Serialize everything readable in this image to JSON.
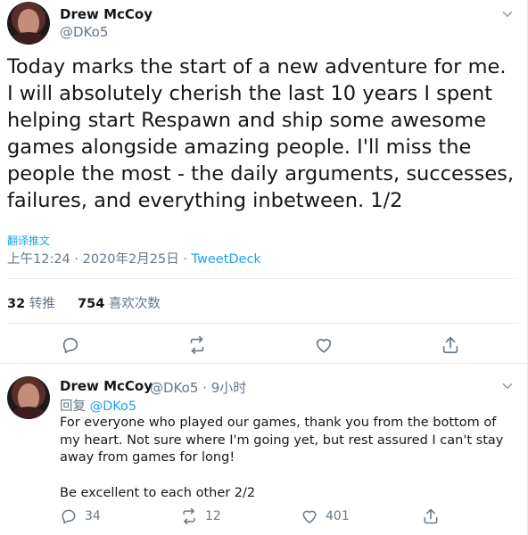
{
  "main_tweet": {
    "author_name": "Drew McCoy",
    "author_handle": "@DKo5",
    "text": "Today marks the start of a new adventure for me. I will absolutely cherish the last 10 years I spent helping start Respawn and ship some awesome games alongside amazing people. I'll miss the people the most - the daily arguments, successes, failures, and everything inbetween. 1/2",
    "translate_label": "翻译推文",
    "timestamp": "上午12:24 · 2020年2月25日",
    "meta_separator": " · ",
    "source": "TweetDeck",
    "retweets_count": "32",
    "retweets_label": "转推",
    "likes_count": "754",
    "likes_label": "喜欢次数"
  },
  "reply_tweet": {
    "author_name": "Drew McCoy",
    "author_handle": "@DKo5",
    "time_separator": "·",
    "time": "9小时",
    "reply_prefix": "回复",
    "reply_mention": "@DKo5",
    "text_para1": "For everyone who played our games, thank you from the bottom of my heart. Not sure where I'm going yet, but rest assured I can't stay away from games for long!",
    "text_para2": "Be excellent to each other 2/2",
    "reply_count": "34",
    "retweet_count": "12",
    "like_count": "401"
  },
  "icons": {
    "caret": "chevron-down-icon",
    "reply": "reply-icon",
    "retweet": "retweet-icon",
    "like": "heart-icon",
    "share": "share-icon"
  },
  "colors": {
    "link": "#1da1f2",
    "secondary_text": "#657786",
    "primary_text": "#14171a",
    "divider": "#e6ecf0"
  }
}
